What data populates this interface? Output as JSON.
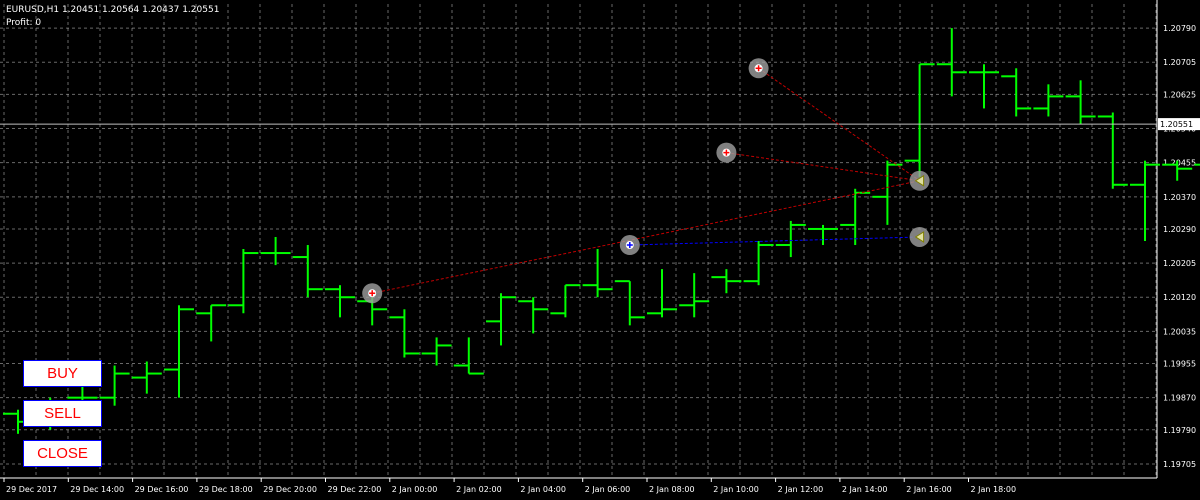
{
  "header": {
    "symbol_line": "EURUSD,H1  1.20451 1.20564 1.20437 1.20551",
    "profit_line": "Profit: 0"
  },
  "buttons": {
    "buy": "BUY",
    "sell": "SELL",
    "close": "CLOSE"
  },
  "colors": {
    "background": "#000000",
    "grid": "#c0c0c0",
    "bar": "#00ff00",
    "current_price_line": "#c0c0c0",
    "sell_trade_line": "#c00000",
    "buy_trade_line": "#0000ff",
    "marker_circle": "#a0a0a0",
    "button_text": "#ff0000",
    "button_border": "#0000ff"
  },
  "chart_data": {
    "type": "ohlc",
    "symbol": "EURUSD",
    "timeframe": "H1",
    "ylim": [
      1.1967,
      1.2085
    ],
    "y_ticks": [
      "1.20790",
      "1.20705",
      "1.20625",
      "1.20540",
      "1.20455",
      "1.20370",
      "1.20290",
      "1.20205",
      "1.20120",
      "1.20035",
      "1.19955",
      "1.19870",
      "1.19790",
      "1.19705"
    ],
    "x_tick_labels": [
      "29 Dec 2017",
      "29 Dec 14:00",
      "29 Dec 16:00",
      "29 Dec 18:00",
      "29 Dec 20:00",
      "29 Dec 22:00",
      "2 Jan 00:00",
      "2 Jan 02:00",
      "2 Jan 04:00",
      "2 Jan 06:00",
      "2 Jan 08:00",
      "2 Jan 10:00",
      "2 Jan 12:00",
      "2 Jan 14:00",
      "2 Jan 16:00",
      "2 Jan 18:00"
    ],
    "current_price": "1.20551",
    "bars": [
      {
        "o": 1.1983,
        "h": 1.1984,
        "l": 1.1978,
        "c": 1.1981
      },
      {
        "o": 1.1981,
        "h": 1.1987,
        "l": 1.1979,
        "c": 1.1982
      },
      {
        "o": 1.1987,
        "h": 1.199,
        "l": 1.198,
        "c": 1.1987
      },
      {
        "o": 1.1987,
        "h": 1.1995,
        "l": 1.1985,
        "c": 1.1993
      },
      {
        "o": 1.1992,
        "h": 1.1996,
        "l": 1.1988,
        "c": 1.1993
      },
      {
        "o": 1.1994,
        "h": 1.201,
        "l": 1.1987,
        "c": 1.2009
      },
      {
        "o": 1.2008,
        "h": 1.201,
        "l": 1.2001,
        "c": 1.201
      },
      {
        "o": 1.201,
        "h": 1.2024,
        "l": 1.2008,
        "c": 1.2023
      },
      {
        "o": 1.2023,
        "h": 1.2027,
        "l": 1.202,
        "c": 1.2023
      },
      {
        "o": 1.2022,
        "h": 1.2025,
        "l": 1.2012,
        "c": 1.2014
      },
      {
        "o": 1.2014,
        "h": 1.2015,
        "l": 1.2007,
        "c": 1.2012
      },
      {
        "o": 1.2011,
        "h": 1.2012,
        "l": 1.2005,
        "c": 1.2009
      },
      {
        "o": 1.2007,
        "h": 1.2009,
        "l": 1.1997,
        "c": 1.1998
      },
      {
        "o": 1.1998,
        "h": 1.2002,
        "l": 1.1995,
        "c": 1.2
      },
      {
        "o": 1.1995,
        "h": 1.2002,
        "l": 1.1993,
        "c": 1.1993
      },
      {
        "o": 1.2006,
        "h": 1.2013,
        "l": 1.2,
        "c": 1.2012
      },
      {
        "o": 1.2011,
        "h": 1.2012,
        "l": 1.2003,
        "c": 1.2009
      },
      {
        "o": 1.2008,
        "h": 1.2015,
        "l": 1.2007,
        "c": 1.2015
      },
      {
        "o": 1.2015,
        "h": 1.2024,
        "l": 1.2012,
        "c": 1.2014
      },
      {
        "o": 1.2016,
        "h": 1.2016,
        "l": 1.2005,
        "c": 1.2007
      },
      {
        "o": 1.2008,
        "h": 1.2019,
        "l": 1.2007,
        "c": 1.2009
      },
      {
        "o": 1.201,
        "h": 1.2018,
        "l": 1.2007,
        "c": 1.2011
      },
      {
        "o": 1.2017,
        "h": 1.2019,
        "l": 1.2013,
        "c": 1.2016
      },
      {
        "o": 1.2016,
        "h": 1.2026,
        "l": 1.2015,
        "c": 1.2025
      },
      {
        "o": 1.2025,
        "h": 1.2031,
        "l": 1.2022,
        "c": 1.203
      },
      {
        "o": 1.2029,
        "h": 1.203,
        "l": 1.2025,
        "c": 1.2029
      },
      {
        "o": 1.203,
        "h": 1.2039,
        "l": 1.2025,
        "c": 1.2038
      },
      {
        "o": 1.2037,
        "h": 1.2046,
        "l": 1.203,
        "c": 1.2045
      },
      {
        "o": 1.2046,
        "h": 1.207,
        "l": 1.2042,
        "c": 1.207
      },
      {
        "o": 1.207,
        "h": 1.2079,
        "l": 1.2062,
        "c": 1.2068
      },
      {
        "o": 1.2068,
        "h": 1.207,
        "l": 1.2059,
        "c": 1.2068
      },
      {
        "o": 1.2067,
        "h": 1.2069,
        "l": 1.2057,
        "c": 1.2059
      },
      {
        "o": 1.2059,
        "h": 1.2065,
        "l": 1.2057,
        "c": 1.2062
      },
      {
        "o": 1.2062,
        "h": 1.2066,
        "l": 1.2055,
        "c": 1.2057
      },
      {
        "o": 1.2057,
        "h": 1.2058,
        "l": 1.2039,
        "c": 1.204
      },
      {
        "o": 1.204,
        "h": 1.2046,
        "l": 1.2026,
        "c": 1.2045
      },
      {
        "o": 1.2045,
        "h": 1.2046,
        "l": 1.2041,
        "c": 1.2044
      },
      {
        "o": 1.2045,
        "h": 1.2056,
        "l": 1.2044,
        "c": 1.2055
      }
    ],
    "trade_markers": [
      {
        "bar": 11,
        "price": 1.2013,
        "kind": "sell-open"
      },
      {
        "bar": 19,
        "price": 1.2025,
        "kind": "buy-open"
      },
      {
        "bar": 22,
        "price": 1.2048,
        "kind": "sell-open"
      },
      {
        "bar": 23,
        "price": 1.2069,
        "kind": "sell-open"
      },
      {
        "bar": 28,
        "price": 1.2041,
        "kind": "close"
      },
      {
        "bar": 28,
        "price": 1.2027,
        "kind": "close"
      }
    ],
    "trade_lines": [
      {
        "from": 0,
        "to": 4,
        "kind": "sell"
      },
      {
        "from": 2,
        "to": 4,
        "kind": "sell"
      },
      {
        "from": 3,
        "to": 4,
        "kind": "sell"
      },
      {
        "from": 1,
        "to": 5,
        "kind": "buy"
      }
    ],
    "grid": true
  }
}
